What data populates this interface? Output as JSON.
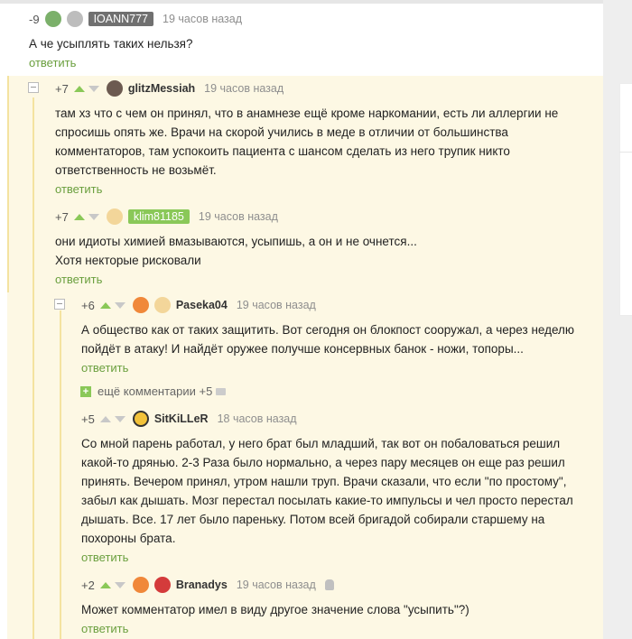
{
  "comments": [
    {
      "rating": "-9",
      "nick": "IOANN777",
      "time": "19 часов назад",
      "lines": [
        "А че усыплять таких нельзя?"
      ],
      "reply": "ответить"
    },
    {
      "rating": "+7",
      "nick": "glitzMessiah",
      "time": "19 часов назад",
      "lines": [
        "там хз что с чем он принял, что в анамнезе ещё кроме наркомании, есть ли аллергии не",
        "спросишь опять же. Врачи на скорой учились в меде в отличии от большинства",
        "комментаторов, там успокоить пациента с шансом сделать из него трупик никто",
        "ответственность не возьмёт."
      ],
      "reply": "ответить"
    },
    {
      "rating": "+7",
      "nick": "klim81185",
      "time": "19 часов назад",
      "lines": [
        "они идиоты химией вмазываются, усыпишь, а он и не очнется...",
        "Хотя некторые рисковали"
      ],
      "reply": "ответить"
    },
    {
      "rating": "+6",
      "nick": "Paseka04",
      "time": "19 часов назад",
      "lines": [
        "А общество как от таких защитить. Вот сегодня он блокпост сооружал, а через неделю",
        "пойдёт в атаку! И найдёт оружее получше консервных банок - ножи, топоры..."
      ],
      "reply": "ответить"
    },
    {
      "rating": "+5",
      "nick": "SitKiLLeR",
      "time": "18 часов назад",
      "lines": [
        "Со мной парень работал, у него брат был младший, так вот он побаловаться решил",
        "какой-то дрянью. 2-3 Раза было нормально, а через пару месяцев он еще раз решил",
        "принять. Вечером принял, утром нашли труп. Врачи сказали, что если \"по простому\",",
        "забыл как дышать. Мозг перестал посылать какие-то импульсы и чел просто перестал",
        "дышать. Все. 17 лет было пареньку. Потом всей бригадой собирали старшему на",
        "похороны брата."
      ],
      "reply": "ответить"
    },
    {
      "rating": "+2",
      "nick": "Branadys",
      "time": "19 часов назад",
      "lines": [
        "Может комментатор имел в виду другое значение слова \"усыпить\"?)"
      ],
      "reply": "ответить"
    }
  ],
  "more_comments": "ещё комментарии +5",
  "colors": {
    "accent": "#8ac858",
    "reply": "#6a9f3e",
    "nick_badge_1": "#707070",
    "nick_badge_2": "#8ac858",
    "tree_bg": "#fdf8e4"
  },
  "icons": [
    "user-avatar",
    "upvote-arrow",
    "downvote-arrow",
    "collapse-icon",
    "comment-icon",
    "android-icon"
  ]
}
